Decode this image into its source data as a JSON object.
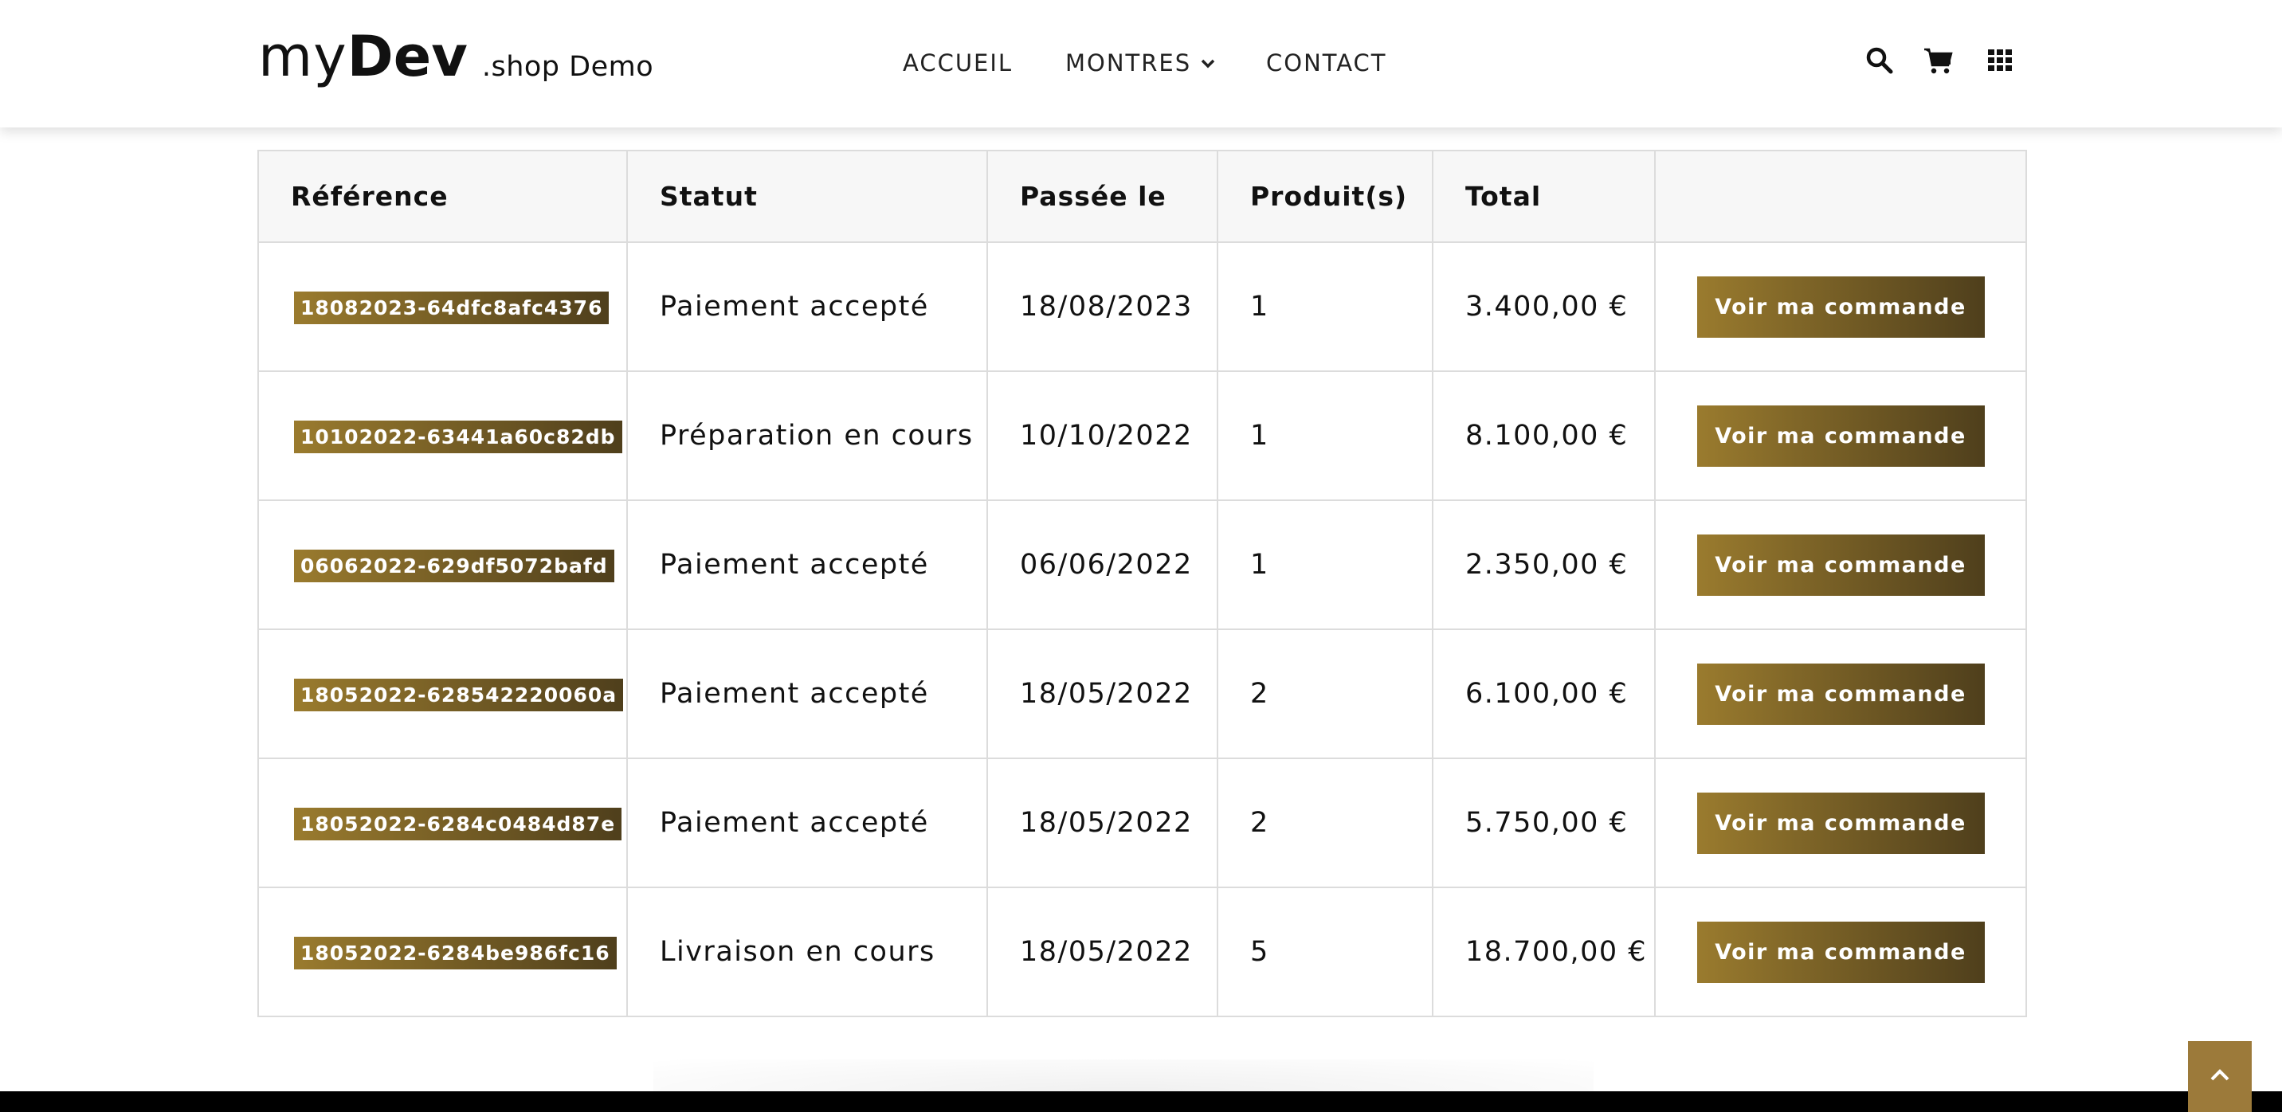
{
  "header": {
    "logo": {
      "my": "my",
      "dev": "Dev",
      "shop": ".shop Demo"
    },
    "nav": {
      "home": "ACCUEIL",
      "watches": "MONTRES",
      "contact": "CONTACT"
    },
    "icons": [
      "search-icon",
      "cart-icon",
      "grid-icon"
    ]
  },
  "orders": {
    "columns": {
      "reference": "Référence",
      "status": "Statut",
      "date": "Passée le",
      "products": "Produit(s)",
      "total": "Total",
      "action": ""
    },
    "rows": [
      {
        "reference": "18082023-64dfc8afc4376",
        "status": "Paiement accepté",
        "date": "18/08/2023",
        "products": "1",
        "total": "3.400,00 €",
        "button": "Voir ma commande"
      },
      {
        "reference": "10102022-63441a60c82db",
        "status": "Préparation en cours",
        "date": "10/10/2022",
        "products": "1",
        "total": "8.100,00 €",
        "button": "Voir ma commande"
      },
      {
        "reference": "06062022-629df5072bafd",
        "status": "Paiement accepté",
        "date": "06/06/2022",
        "products": "1",
        "total": "2.350,00 €",
        "button": "Voir ma commande"
      },
      {
        "reference": "18052022-628542220060a",
        "status": "Paiement accepté",
        "date": "18/05/2022",
        "products": "2",
        "total": "6.100,00 €",
        "button": "Voir ma commande"
      },
      {
        "reference": "18052022-6284c0484d87e",
        "status": "Paiement accepté",
        "date": "18/05/2022",
        "products": "2",
        "total": "5.750,00 €",
        "button": "Voir ma commande"
      },
      {
        "reference": "18052022-6284be986fc16",
        "status": "Livraison en cours",
        "date": "18/05/2022",
        "products": "5",
        "total": "18.700,00 €",
        "button": "Voir ma commande"
      }
    ]
  },
  "colors": {
    "accent_start": "#9a7b2e",
    "accent_end": "#4f3f1c",
    "scroll_top_bg": "#9c7a3a",
    "footer": "#000000"
  }
}
